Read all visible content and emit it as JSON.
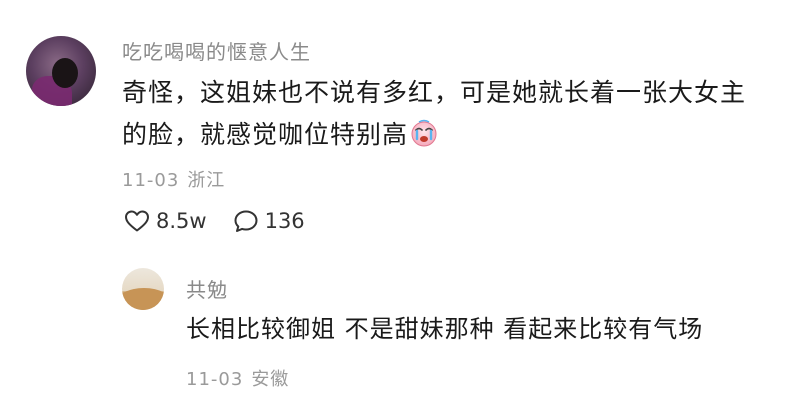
{
  "comment": {
    "username": "吃吃喝喝的惬意人生",
    "content_lines": [
      "奇怪，这姐妹也不说有多红，可是她就长着一张大女主",
      "的脸，就感觉咖位特别高"
    ],
    "emoji": "crying-face",
    "date": "11-03",
    "location": "浙江",
    "likes": "8.5w",
    "replies": "136"
  },
  "reply": {
    "username": "共勉",
    "content": "长相比较御姐 不是甜妹那种 看起来比较有气场",
    "date": "11-03",
    "location": "安徽"
  }
}
